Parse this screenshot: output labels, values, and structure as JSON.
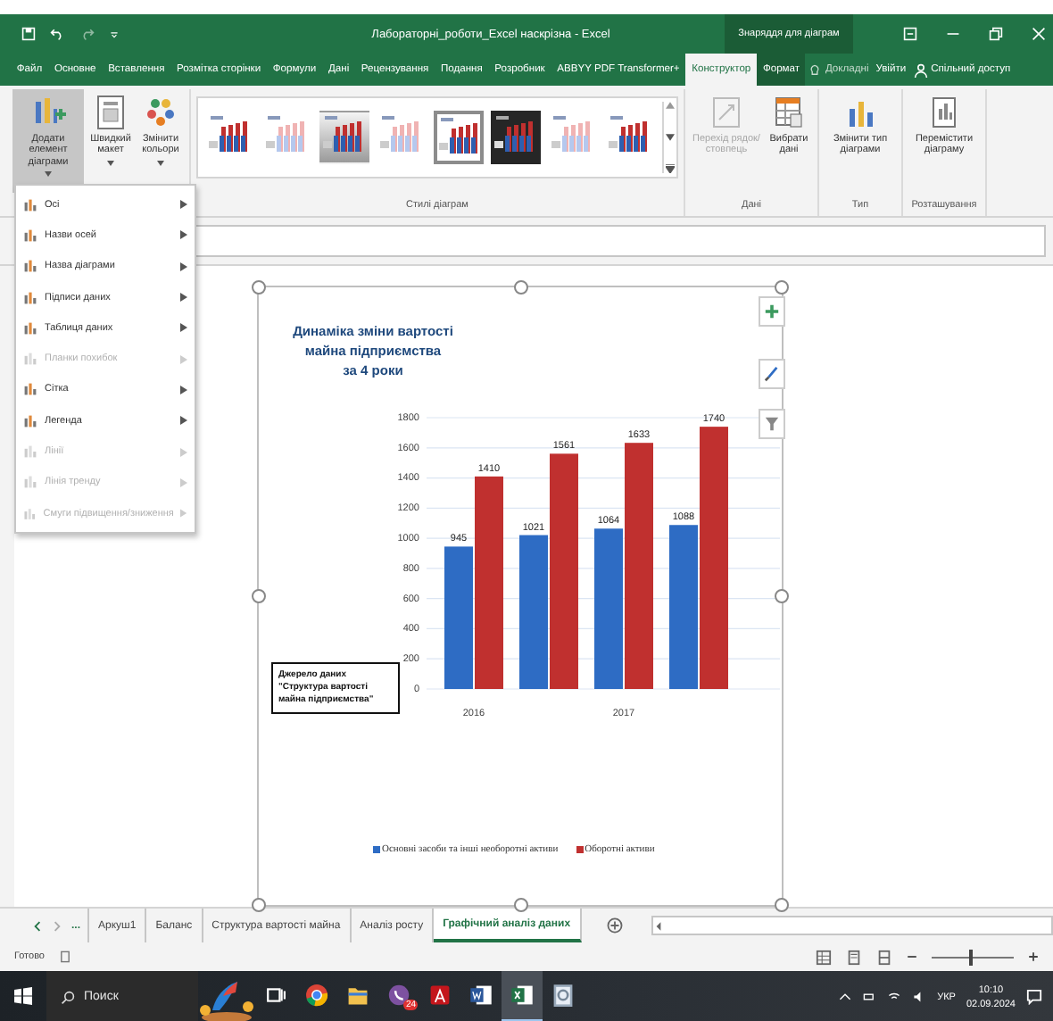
{
  "title_bar": {
    "title": "Лабораторні_роботи_Excel наскрізна - Excel",
    "context_label": "Знаряддя для діаграм"
  },
  "tabs": [
    {
      "label": "Файл",
      "selected": false,
      "kind": "normal"
    },
    {
      "label": "Основне",
      "selected": false,
      "kind": "normal"
    },
    {
      "label": "Вставлення",
      "selected": false,
      "kind": "normal"
    },
    {
      "label": "Розмітка сторінки",
      "selected": false,
      "kind": "normal"
    },
    {
      "label": "Формули",
      "selected": false,
      "kind": "normal"
    },
    {
      "label": "Дані",
      "selected": false,
      "kind": "normal"
    },
    {
      "label": "Рецензування",
      "selected": false,
      "kind": "normal"
    },
    {
      "label": "Подання",
      "selected": false,
      "kind": "normal"
    },
    {
      "label": "Розробник",
      "selected": false,
      "kind": "normal"
    },
    {
      "label": "ABBYY PDF Transformer+",
      "selected": false,
      "kind": "normal"
    },
    {
      "label": "Конструктор",
      "selected": true,
      "kind": "context"
    },
    {
      "label": "Формат",
      "selected": false,
      "kind": "context"
    }
  ],
  "account": [
    {
      "label": "Докладні",
      "kind": "tell"
    },
    {
      "label": "Увійти",
      "kind": "signin"
    },
    {
      "label": "Спільний доступ",
      "kind": "share"
    }
  ],
  "ribbon_groups": [
    {
      "kind": "buttons",
      "buttons": [
        {
          "label": "Додати елемент діаграми",
          "pressed": true,
          "disabled": false,
          "dropdown": true
        },
        {
          "label": "Швидкий макет",
          "pressed": false,
          "disabled": false,
          "dropdown": true
        },
        {
          "label": "Змінити кольори",
          "pressed": false,
          "disabled": false,
          "dropdown": true
        }
      ]
    },
    {
      "kind": "gallery",
      "label": "Стилі діаграм",
      "styles": [
        {
          "selected": false
        },
        {
          "selected": false
        },
        {
          "selected": false
        },
        {
          "selected": false
        },
        {
          "selected": true
        },
        {
          "selected": false
        },
        {
          "selected": false
        },
        {
          "selected": false
        }
      ]
    },
    {
      "kind": "buttons",
      "label": "Дані",
      "buttons": [
        {
          "label": "Перехід рядок/ стовпець",
          "pressed": false,
          "disabled": true,
          "dropdown": false
        },
        {
          "label": "Вибрати дані",
          "pressed": false,
          "disabled": false,
          "dropdown": false
        }
      ]
    },
    {
      "kind": "buttons",
      "label": "Тип",
      "buttons": [
        {
          "label": "Змінити тип діаграми",
          "pressed": false,
          "disabled": false,
          "dropdown": false
        }
      ]
    },
    {
      "kind": "buttons",
      "label": "Розташування",
      "buttons": [
        {
          "label": "Перемістити діаграму",
          "pressed": false,
          "disabled": false,
          "dropdown": false
        }
      ]
    }
  ],
  "chart_element_menu": [
    {
      "label": "Осі",
      "disabled": false
    },
    {
      "label": "Назви осей",
      "disabled": false
    },
    {
      "label": "Назва діаграми",
      "disabled": false
    },
    {
      "label": "Підписи даних",
      "disabled": false
    },
    {
      "label": "Таблиця даних",
      "disabled": false
    },
    {
      "label": "Планки похибок",
      "disabled": true
    },
    {
      "label": "Сітка",
      "disabled": false
    },
    {
      "label": "Легенда",
      "disabled": false
    },
    {
      "label": "Лінії",
      "disabled": true
    },
    {
      "label": "Лінія тренду",
      "disabled": true
    },
    {
      "label": "Смуги підвищення/зниження",
      "disabled": true
    }
  ],
  "chart": {
    "chart_data": {
      "type": "bar",
      "title": "Динаміка зміни вартості\nмайна підприємства\nза 4 роки",
      "categories": [
        "2016",
        null,
        "2017",
        null
      ],
      "yticks": [
        0,
        200,
        400,
        600,
        800,
        1000,
        1200,
        1400,
        1600,
        1800
      ],
      "ylim": [
        0,
        1800
      ],
      "series": [
        {
          "name": "Основні засоби та інші необоротні активи",
          "color": "#2e6cc4",
          "values": [
            945,
            1021,
            1064,
            1088
          ]
        },
        {
          "name": "Оборотні активи",
          "color": "#c0302f",
          "values": [
            1410,
            1561,
            1633,
            1740
          ]
        }
      ],
      "data_labels": true,
      "legend": "bottom",
      "grid": true,
      "annotations": [
        "Джерело даних \"Структура вартості майна підприємства\""
      ]
    }
  },
  "sheet_tabs": {
    "more": "...",
    "tabs": [
      {
        "label": "Аркуш1",
        "selected": false
      },
      {
        "label": "Баланс",
        "selected": false
      },
      {
        "label": "Структура вартості майна",
        "selected": false
      },
      {
        "label": "Аналіз росту",
        "selected": false
      },
      {
        "label": "Графічний аналіз даних",
        "selected": true
      }
    ]
  },
  "status_bar": {
    "status": "Готово",
    "zoom": {
      "level": 0.45
    }
  },
  "taskbar": {
    "search": {
      "placeholder": "Поиск"
    },
    "apps": [
      {
        "kind": "task-view",
        "active": false
      },
      {
        "kind": "chrome",
        "active": false
      },
      {
        "kind": "explorer",
        "active": false
      },
      {
        "kind": "viber",
        "active": false,
        "badge": "24"
      },
      {
        "kind": "acrobat",
        "active": false
      },
      {
        "kind": "word",
        "active": false
      },
      {
        "kind": "excel",
        "active": true
      },
      {
        "kind": "viewer",
        "active": false
      }
    ],
    "language": "УКР",
    "time": "10:10",
    "date": "02.09.2024"
  }
}
